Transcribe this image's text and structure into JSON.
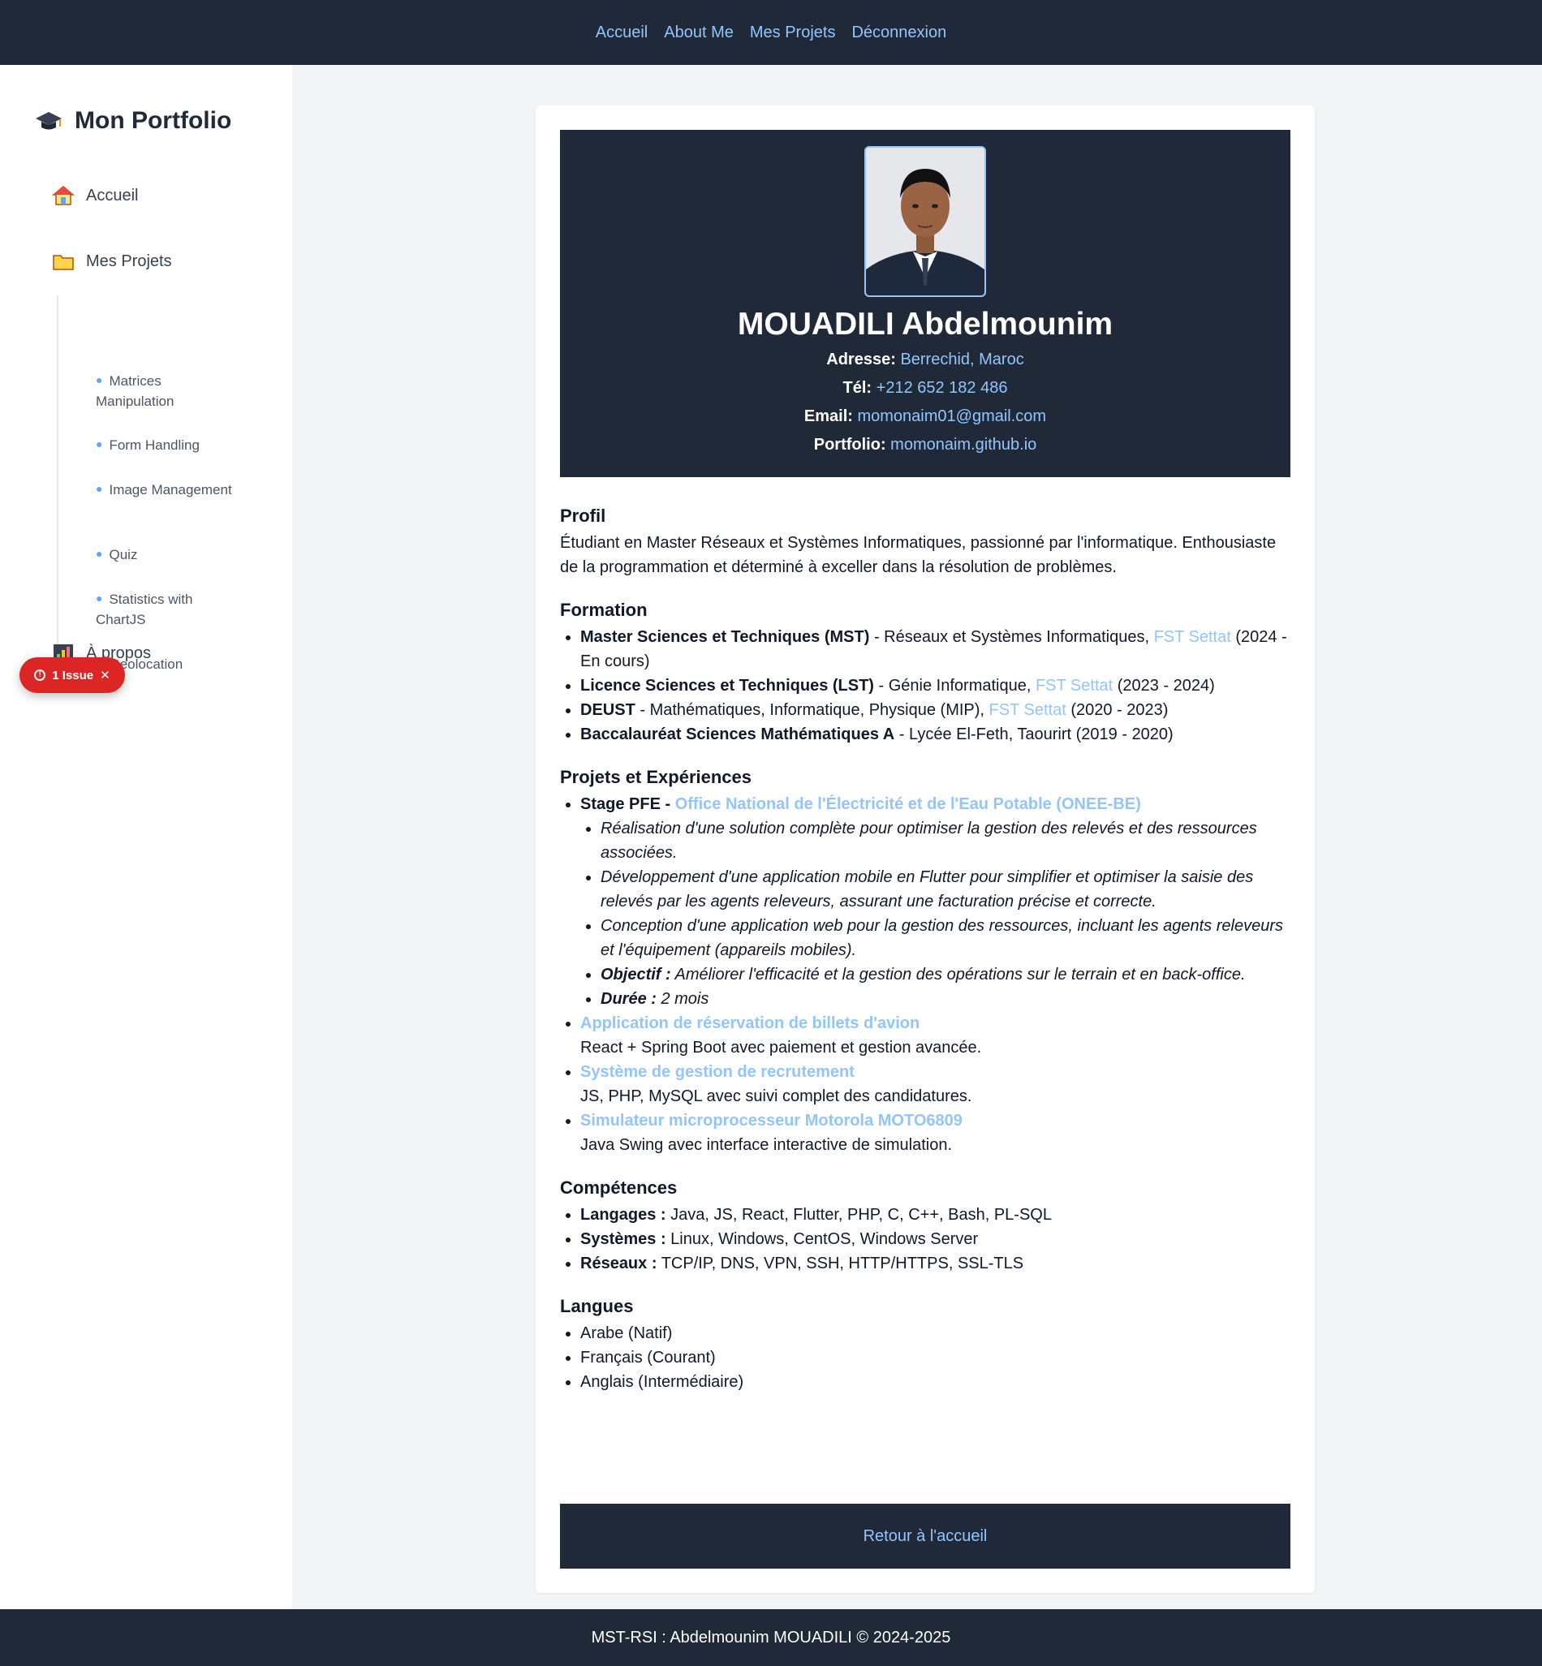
{
  "topnav": {
    "links": [
      "Accueil",
      "About Me",
      "Mes Projets",
      "Déconnexion"
    ]
  },
  "sidebar": {
    "brand": "Mon Portfolio",
    "accueil": "Accueil",
    "projets": "Mes Projets",
    "sub_items": [
      "Matrices Manipulation",
      "Form Handling",
      "Image Management",
      "Quiz",
      "Statistics with ChartJS",
      "Geolocation"
    ],
    "apropos": "À propos"
  },
  "issue_badge": {
    "label": "1 Issue",
    "close": "✕"
  },
  "header": {
    "name": "MOUADILI Abdelmounim",
    "address_label": "Adresse:",
    "address": "Berrechid, Maroc",
    "tel_label": "Tél:",
    "tel": "+212 652 182 486",
    "email_label": "Email:",
    "email": "momonaim01@gmail.com",
    "portfolio_label": "Portfolio:",
    "portfolio": "momonaim.github.io"
  },
  "profil": {
    "title": "Profil",
    "text": "Étudiant en Master Réseaux et Systèmes Informatiques, passionné par l'informatique. Enthousiaste de la programmation et déterminé à exceller dans la résolution de problèmes."
  },
  "formation": {
    "title": "Formation",
    "items": [
      {
        "degree": "Master Sciences et Techniques (MST)",
        "field": " - Réseaux et Systèmes Informatiques, ",
        "school": "FST Settat",
        "years": " (2024 - En cours)"
      },
      {
        "degree": "Licence Sciences et Techniques (LST)",
        "field": " - Génie Informatique, ",
        "school": "FST Settat",
        "years": " (2023 - 2024)"
      },
      {
        "degree": "DEUST",
        "field": " - Mathématiques, Informatique, Physique (MIP), ",
        "school": "FST Settat",
        "years": " (2020 - 2023)"
      },
      {
        "degree": "Baccalauréat Sciences Mathématiques A",
        "field": " - Lycée El-Feth, Taourirt (2019 - 2020)",
        "school": "",
        "years": ""
      }
    ]
  },
  "projets": {
    "title": "Projets et Expériences",
    "stage_label": "Stage PFE - ",
    "stage_org": "Office National de l'Électricité et de l'Eau Potable (ONEE-BE)",
    "stage_points": [
      "Réalisation d'une solution complète pour optimiser la gestion des relevés et des ressources associées.",
      "Développement d'une application mobile en Flutter pour simplifier et optimiser la saisie des relevés par les agents releveurs, assurant une facturation précise et correcte.",
      "Conception d'une application web pour la gestion des ressources, incluant les agents releveurs et l'équipement (appareils mobiles)."
    ],
    "objectif_label": "Objectif :",
    "objectif": " Améliorer l'efficacité et la gestion des opérations sur le terrain et en back-office.",
    "duree_label": "Durée :",
    "duree": " 2 mois",
    "items": [
      {
        "title": "Application de réservation de billets d'avion",
        "desc": "React + Spring Boot avec paiement et gestion avancée."
      },
      {
        "title": "Système de gestion de recrutement",
        "desc": "JS, PHP, MySQL avec suivi complet des candidatures."
      },
      {
        "title": "Simulateur microprocesseur Motorola MOTO6809",
        "desc": "Java Swing avec interface interactive de simulation."
      }
    ]
  },
  "competences": {
    "title": "Compétences",
    "items": [
      {
        "label": "Langages :",
        "value": " Java, JS, React, Flutter, PHP, C, C++, Bash, PL-SQL"
      },
      {
        "label": "Systèmes :",
        "value": " Linux, Windows, CentOS, Windows Server"
      },
      {
        "label": "Réseaux :",
        "value": " TCP/IP, DNS, VPN, SSH, HTTP/HTTPS, SSL-TLS"
      }
    ]
  },
  "langues": {
    "title": "Langues",
    "items": [
      "Arabe (Natif)",
      "Français (Courant)",
      "Anglais (Intermédiaire)"
    ]
  },
  "back_button": "Retour à l'accueil",
  "footer": "MST-RSI : Abdelmounim MOUADILI © 2024-2025",
  "colors": {
    "dark": "#1f2937",
    "link": "#93c5fd",
    "issue": "#dc2626"
  },
  "icons": [
    "graduation-cap-icon",
    "house-icon",
    "folder-icon",
    "chart-icon",
    "alert-circle-icon",
    "close-icon"
  ]
}
